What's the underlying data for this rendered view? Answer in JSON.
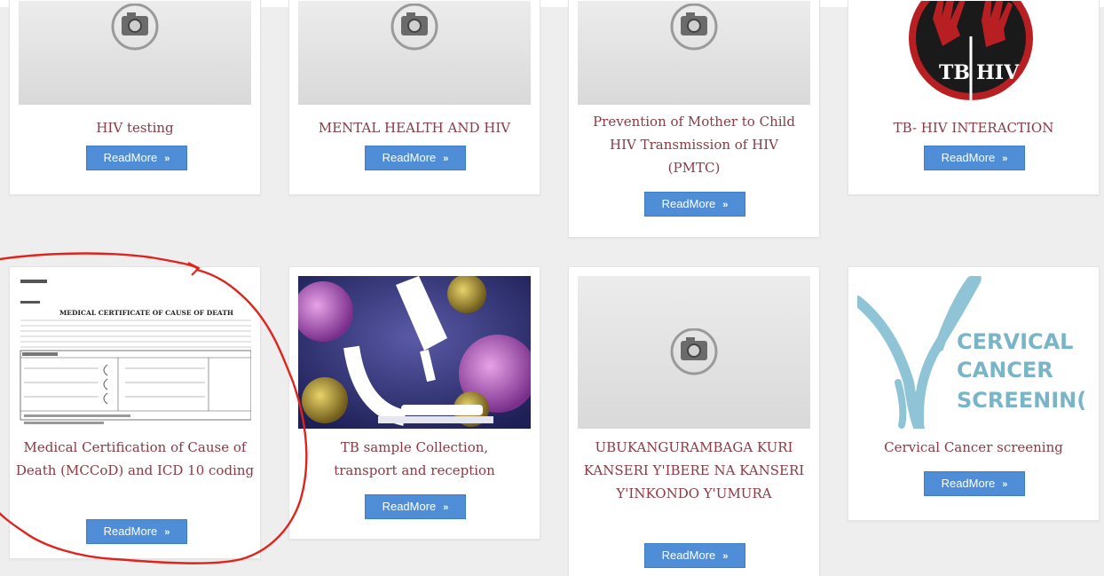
{
  "cards": [
    {
      "title": "HIV testing",
      "button": "ReadMore",
      "image": "placeholder-camera-icon"
    },
    {
      "title": "MENTAL HEALTH AND HIV",
      "button": "ReadMore",
      "image": "placeholder-camera-icon"
    },
    {
      "title": "Prevention of Mother to Child HIV Transmission of HIV (PMTC)",
      "button": "ReadMore",
      "image": "placeholder-camera-icon"
    },
    {
      "title": "TB- HIV INTERACTION",
      "button": "ReadMore",
      "image": "tb-hiv-logo",
      "image_text": [
        "TB",
        "HIV"
      ]
    },
    {
      "title": "Medical Certification of Cause of Death (MCCoD) and ICD 10 coding",
      "button": "ReadMore",
      "image": "death-certificate-document",
      "image_text": "MEDICAL CERTIFICATE OF CAUSE OF DEATH"
    },
    {
      "title": "TB sample Collection, transport and reception",
      "button": "ReadMore",
      "image": "microscope-virus-illustration"
    },
    {
      "title": "UBUKANGURAMBAGA KURI KANSERI Y'IBERE NA KANSERI Y'INKONDO Y'UMURA",
      "button": "ReadMore",
      "image": "placeholder-camera-icon"
    },
    {
      "title": "Cervical Cancer screening",
      "button": "ReadMore",
      "image": "cervical-cancer-ribbon-logo",
      "image_text": [
        "CERVICAL",
        "CANCER",
        "SCREENIN("
      ]
    }
  ],
  "colors": {
    "title": "#8a3a44",
    "button": "#4f8ed6",
    "annotation": "#e0231c"
  },
  "button_icon": "double-chevron-right-icon"
}
